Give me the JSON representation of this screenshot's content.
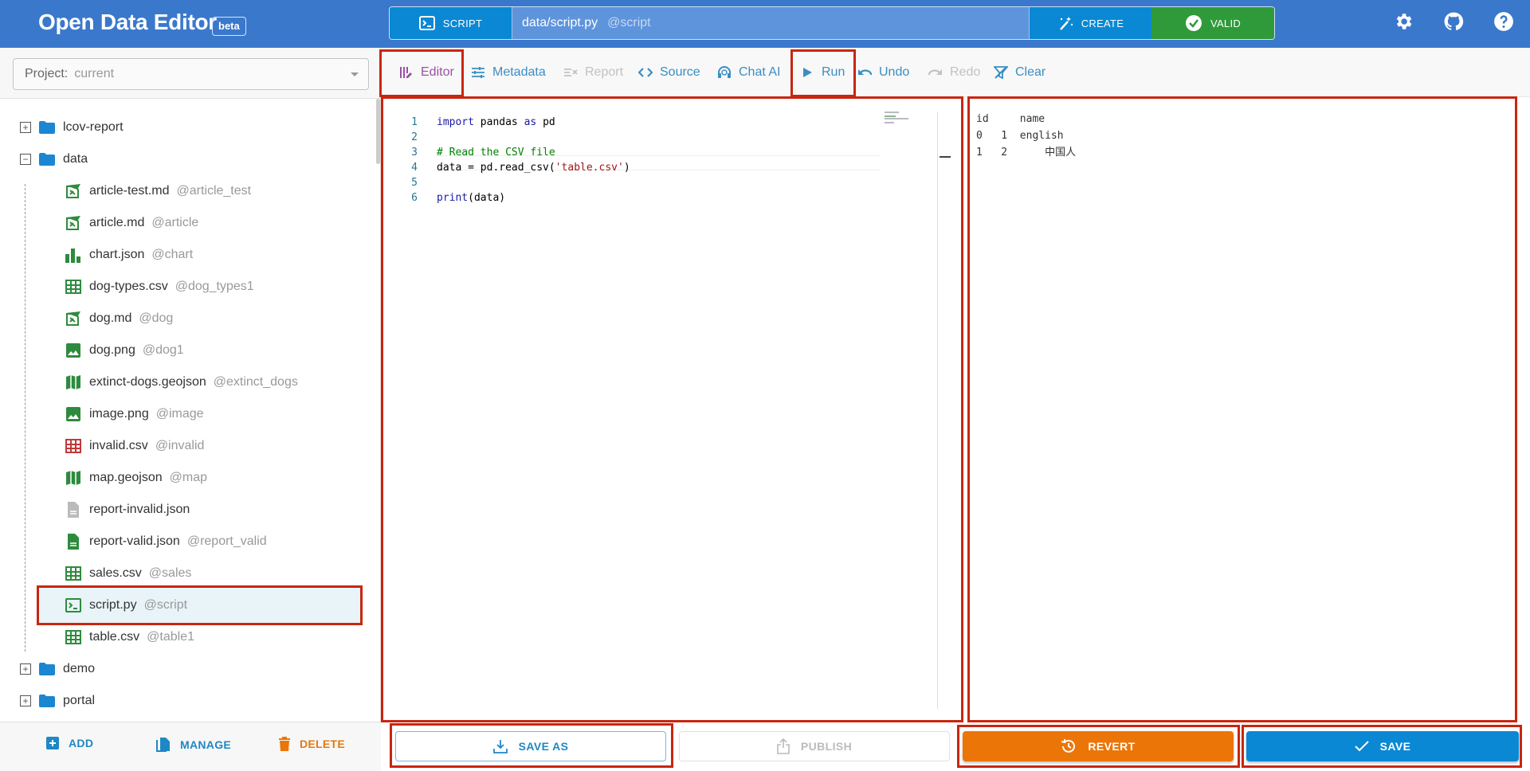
{
  "header": {
    "app_title": "Open Data Editor",
    "beta_label": "beta",
    "file_type_label": "SCRIPT",
    "file_path": "data/script.py",
    "file_alias": "@script",
    "create_label": "CREATE",
    "valid_label": "VALID",
    "icons": [
      "gear-icon",
      "github-icon",
      "help-icon"
    ]
  },
  "sidebar": {
    "project_label": "Project:",
    "project_value": "current",
    "tree": [
      {
        "name": "lcov-report",
        "alias": "",
        "type": "folder",
        "expanded": false,
        "depth": 0
      },
      {
        "name": "data",
        "alias": "",
        "type": "folder",
        "expanded": true,
        "depth": 0
      },
      {
        "name": "article-test.md",
        "alias": "@article_test",
        "type": "article",
        "depth": 1
      },
      {
        "name": "article.md",
        "alias": "@article",
        "type": "article",
        "depth": 1
      },
      {
        "name": "chart.json",
        "alias": "@chart",
        "type": "chart",
        "depth": 1
      },
      {
        "name": "dog-types.csv",
        "alias": "@dog_types1",
        "type": "table",
        "depth": 1
      },
      {
        "name": "dog.md",
        "alias": "@dog",
        "type": "article",
        "depth": 1
      },
      {
        "name": "dog.png",
        "alias": "@dog1",
        "type": "image",
        "depth": 1
      },
      {
        "name": "extinct-dogs.geojson",
        "alias": "@extinct_dogs",
        "type": "map",
        "depth": 1
      },
      {
        "name": "image.png",
        "alias": "@image",
        "type": "image",
        "depth": 1
      },
      {
        "name": "invalid.csv",
        "alias": "@invalid",
        "type": "table-invalid",
        "depth": 1
      },
      {
        "name": "map.geojson",
        "alias": "@map",
        "type": "map",
        "depth": 1
      },
      {
        "name": "report-invalid.json",
        "alias": "",
        "type": "file-plain",
        "depth": 1
      },
      {
        "name": "report-valid.json",
        "alias": "@report_valid",
        "type": "file-valid",
        "depth": 1
      },
      {
        "name": "sales.csv",
        "alias": "@sales",
        "type": "table",
        "depth": 1
      },
      {
        "name": "script.py",
        "alias": "@script",
        "type": "script",
        "depth": 1,
        "selected": true
      },
      {
        "name": "table.csv",
        "alias": "@table1",
        "type": "table",
        "depth": 1
      },
      {
        "name": "demo",
        "alias": "",
        "type": "folder",
        "expanded": false,
        "depth": 0
      },
      {
        "name": "portal",
        "alias": "",
        "type": "folder",
        "expanded": false,
        "depth": 0
      }
    ],
    "footer": {
      "add_label": "ADD",
      "manage_label": "MANAGE",
      "delete_label": "DELETE"
    }
  },
  "toolbar": {
    "items": [
      {
        "label": "Editor",
        "icon": "editor-icon",
        "state": "active"
      },
      {
        "label": "Metadata",
        "icon": "sliders-icon",
        "state": "enabled"
      },
      {
        "label": "Report",
        "icon": "report-icon",
        "state": "disabled"
      },
      {
        "label": "Source",
        "icon": "code-icon",
        "state": "enabled"
      },
      {
        "label": "Chat AI",
        "icon": "headset-icon",
        "state": "enabled"
      },
      {
        "label": "Run",
        "icon": "play-icon",
        "state": "enabled"
      },
      {
        "label": "Undo",
        "icon": "undo-icon",
        "state": "enabled"
      },
      {
        "label": "Redo",
        "icon": "redo-icon",
        "state": "disabled"
      },
      {
        "label": "Clear",
        "icon": "clear-filter-icon",
        "state": "enabled"
      }
    ]
  },
  "editor": {
    "lines": [
      {
        "n": "1",
        "tokens": [
          {
            "t": "import",
            "c": "kw"
          },
          {
            "t": " pandas ",
            "c": ""
          },
          {
            "t": "as",
            "c": "kw"
          },
          {
            "t": " pd",
            "c": ""
          }
        ]
      },
      {
        "n": "2",
        "tokens": []
      },
      {
        "n": "3",
        "tokens": [
          {
            "t": "# Read the CSV file",
            "c": "cm"
          }
        ]
      },
      {
        "n": "4",
        "tokens": [
          {
            "t": "data = pd.read_csv(",
            "c": ""
          },
          {
            "t": "'table.csv'",
            "c": "st"
          },
          {
            "t": ")",
            "c": ""
          }
        ]
      },
      {
        "n": "5",
        "tokens": []
      },
      {
        "n": "6",
        "tokens": [
          {
            "t": "print",
            "c": "kw"
          },
          {
            "t": "(data)",
            "c": ""
          }
        ]
      }
    ]
  },
  "output": {
    "lines": [
      "id     name",
      "0   1  english",
      "1   2      中国人"
    ]
  },
  "actions": {
    "save_as_label": "SAVE AS",
    "publish_label": "PUBLISH",
    "revert_label": "REVERT",
    "save_label": "SAVE"
  },
  "colors": {
    "header_bg": "#3a78cc",
    "primary": "#0a88d4",
    "valid": "#2f9a3a",
    "revert": "#ec7508",
    "toolbar_active": "#9b4fa8",
    "toolbar_link": "#3a8ec4",
    "file_icon_green": "#2e8b3e",
    "file_icon_invalid": "#c0393b",
    "folder_blue": "#1b86d2",
    "highlight_box": "#c8260f"
  }
}
